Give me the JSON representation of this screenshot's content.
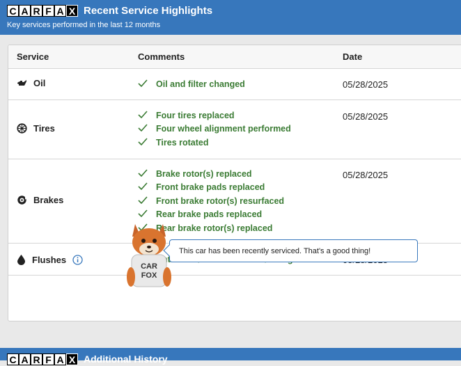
{
  "header": {
    "logo_letters": [
      "C",
      "A",
      "R",
      "F",
      "A",
      "X"
    ],
    "title": "Recent Service Highlights",
    "subtitle": "Key services performed in the last 12 months"
  },
  "table": {
    "columns": {
      "service": "Service",
      "comments": "Comments",
      "date": "Date"
    },
    "rows": [
      {
        "service": "Oil",
        "icon": "oil-can-icon",
        "comments": [
          "Oil and filter changed"
        ],
        "date": "05/28/2025"
      },
      {
        "service": "Tires",
        "icon": "tire-icon",
        "comments": [
          "Four tires replaced",
          "Four wheel alignment performed",
          "Tires rotated"
        ],
        "date": "05/28/2025"
      },
      {
        "service": "Brakes",
        "icon": "brake-icon",
        "comments": [
          "Brake rotor(s) replaced",
          "Front brake pads replaced",
          "Front brake rotor(s) resurfaced",
          "Rear brake pads replaced",
          "Rear brake rotor(s) replaced"
        ],
        "date": "05/28/2025"
      },
      {
        "service": "Flushes",
        "icon": "drop-icon",
        "comments": [
          "Antifreeze/coolant flushed/changed"
        ],
        "date": "05/28/2025"
      }
    ]
  },
  "mascot": {
    "shirt_text": [
      "CAR",
      "FOX"
    ],
    "message": "This car has been recently serviced. That's a good thing!"
  },
  "footer": {
    "title": "Additional History"
  },
  "colors": {
    "brand_blue": "#3777bc",
    "check_green": "#3a7b33"
  }
}
